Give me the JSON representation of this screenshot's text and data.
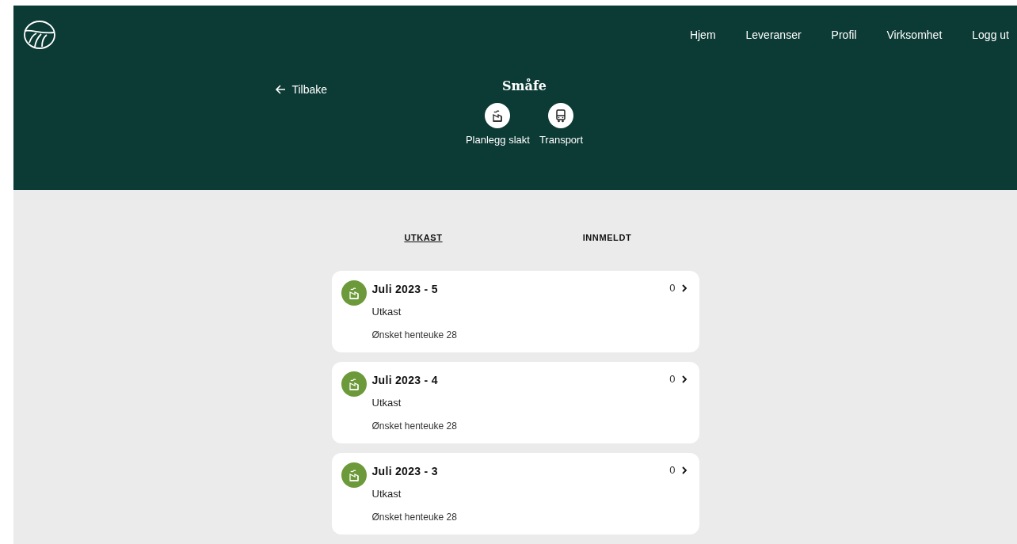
{
  "nav": {
    "items": [
      {
        "label": "Hjem"
      },
      {
        "label": "Leveranser"
      },
      {
        "label": "Profil"
      },
      {
        "label": "Virksomhet"
      },
      {
        "label": "Logg ut"
      }
    ]
  },
  "header": {
    "back": "Tilbake",
    "title": "Småfe",
    "actions": [
      {
        "kind": "factory",
        "label": "Planlegg slakt"
      },
      {
        "kind": "truck",
        "label": "Transport"
      }
    ]
  },
  "tabs": [
    {
      "label": "UTKAST",
      "selected": true
    },
    {
      "label": "INNMELDT",
      "selected": false
    }
  ],
  "cards": [
    {
      "title": "Juli 2023 - 5",
      "status": "Utkast",
      "note": "Ønsket henteuke 28",
      "count": "0"
    },
    {
      "title": "Juli 2023 - 4",
      "status": "Utkast",
      "note": "Ønsket henteuke 28",
      "count": "0"
    },
    {
      "title": "Juli 2023 - 3",
      "status": "Utkast",
      "note": "Ønsket henteuke 28",
      "count": "0"
    }
  ]
}
